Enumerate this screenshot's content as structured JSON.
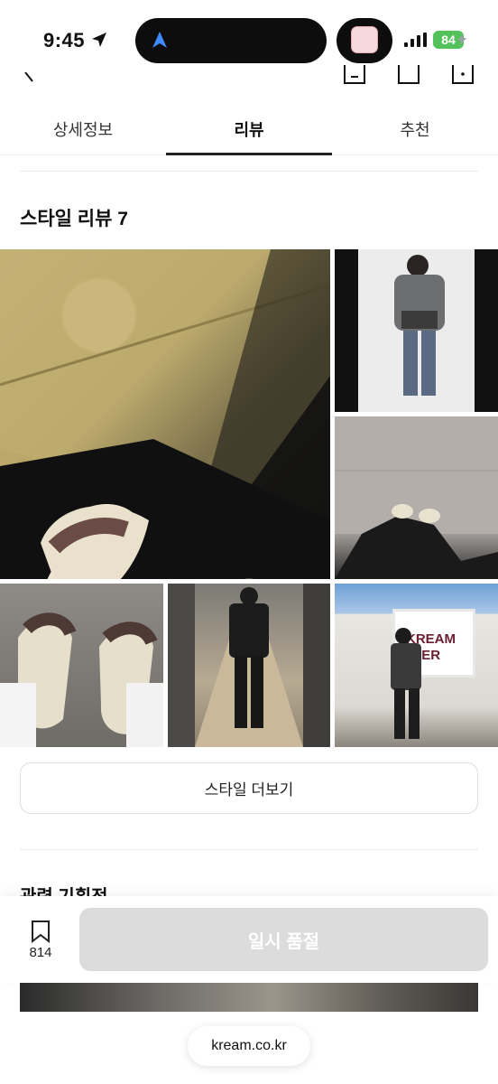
{
  "status_bar": {
    "time": "9:45",
    "battery": "84"
  },
  "tabs": [
    {
      "label": "상세정보",
      "active": false
    },
    {
      "label": "리뷰",
      "active": true
    },
    {
      "label": "추천",
      "active": false
    }
  ],
  "style_review": {
    "title": "스타일 리뷰 7",
    "photo_sign_text": "KREAM\nLTER",
    "more_button": "스타일 더보기"
  },
  "related": {
    "title": "관련 기획전"
  },
  "action_bar": {
    "bookmark_count": "814",
    "primary_button": "일시 품절"
  },
  "browser": {
    "url": "kream.co.kr"
  },
  "colors": {
    "accent": "#222222",
    "disabled_button": "#dcdcdc",
    "battery": "#53c25a"
  }
}
